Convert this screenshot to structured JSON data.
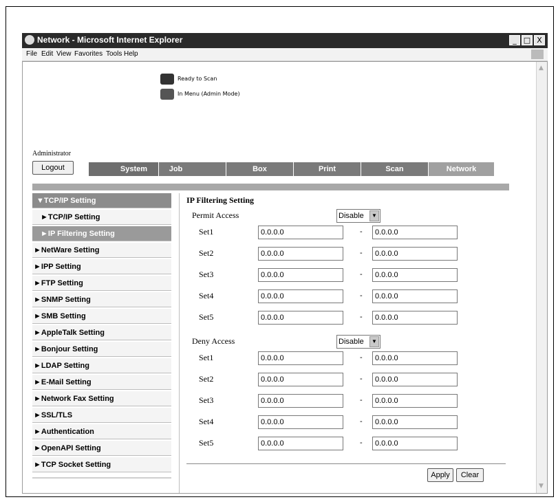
{
  "window": {
    "title": "Network - Microsoft Internet Explorer",
    "minimize": "_",
    "maximize": "□",
    "close": "X",
    "titlebar_color": "#2a2a2a"
  },
  "menubar": {
    "items": [
      "File",
      "Edit",
      "View",
      "Favorites",
      "Tools",
      "Help"
    ]
  },
  "status": {
    "line1": "Ready to Scan",
    "line2": "In Menu (Admin Mode)"
  },
  "user": {
    "role": "Administrator",
    "logout_label": "Logout"
  },
  "nav": {
    "tabs": [
      {
        "label": "System",
        "color": "#6e6e6e"
      },
      {
        "label": "Job",
        "color": "#7a7a7a"
      },
      {
        "label": "Box",
        "color": "#7a7a7a"
      },
      {
        "label": "Print",
        "color": "#7a7a7a"
      },
      {
        "label": "Scan",
        "color": "#7a7a7a"
      },
      {
        "label": "Network",
        "color": "#a0a0a0"
      }
    ]
  },
  "sidebar": {
    "items": [
      {
        "label": "▼TCP/IP Setting"
      },
      {
        "label": "►TCP/IP Setting"
      },
      {
        "label": "►IP Filtering Setting"
      },
      {
        "label": "►NetWare Setting"
      },
      {
        "label": "►IPP Setting"
      },
      {
        "label": "►FTP Setting"
      },
      {
        "label": "►SNMP Setting"
      },
      {
        "label": "►SMB Setting"
      },
      {
        "label": "►AppleTalk Setting"
      },
      {
        "label": "►Bonjour Setting"
      },
      {
        "label": "►LDAP Setting"
      },
      {
        "label": "►E-Mail Setting"
      },
      {
        "label": "►Network Fax Setting"
      },
      {
        "label": "►SSL/TLS"
      },
      {
        "label": "►Authentication"
      },
      {
        "label": "►OpenAPI Setting"
      },
      {
        "label": "►TCP Socket Setting"
      }
    ]
  },
  "form": {
    "title": "IP Filtering Setting",
    "permit": {
      "label": "Permit Access",
      "select_value": "Disable",
      "sets": [
        {
          "label": "Set1",
          "from": "0.0.0.0",
          "to": "0.0.0.0"
        },
        {
          "label": "Set2",
          "from": "0.0.0.0",
          "to": "0.0.0.0"
        },
        {
          "label": "Set3",
          "from": "0.0.0.0",
          "to": "0.0.0.0"
        },
        {
          "label": "Set4",
          "from": "0.0.0.0",
          "to": "0.0.0.0"
        },
        {
          "label": "Set5",
          "from": "0.0.0.0",
          "to": "0.0.0.0"
        }
      ]
    },
    "deny": {
      "label": "Deny Access",
      "select_value": "Disable",
      "sets": [
        {
          "label": "Set1",
          "from": "0.0.0.0",
          "to": "0.0.0.0"
        },
        {
          "label": "Set2",
          "from": "0.0.0.0",
          "to": "0.0.0.0"
        },
        {
          "label": "Set3",
          "from": "0.0.0.0",
          "to": "0.0.0.0"
        },
        {
          "label": "Set4",
          "from": "0.0.0.0",
          "to": "0.0.0.0"
        },
        {
          "label": "Set5",
          "from": "0.0.0.0",
          "to": "0.0.0.0"
        }
      ]
    },
    "dash": "-",
    "apply_label": "Apply",
    "clear_label": "Clear"
  }
}
